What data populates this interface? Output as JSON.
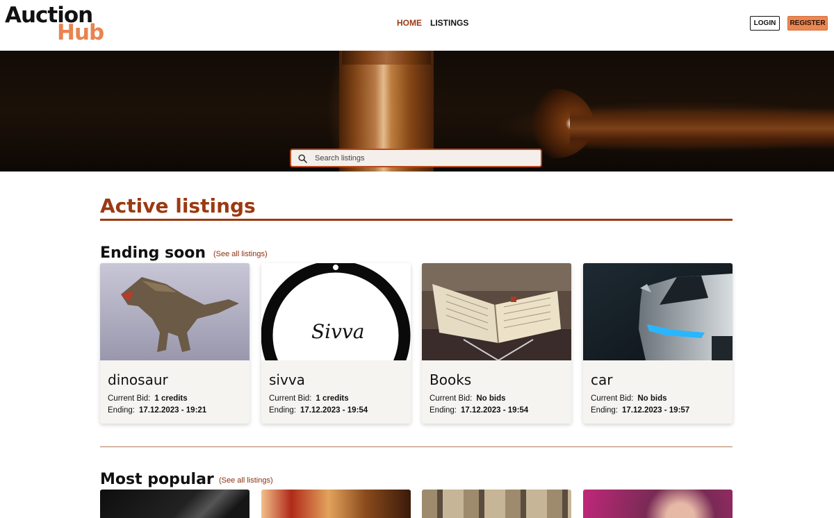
{
  "header": {
    "logo_top": "Auction",
    "logo_bottom": "Hub",
    "nav": [
      {
        "label": "HOME",
        "active": true
      },
      {
        "label": "LISTINGS",
        "active": false
      }
    ],
    "login_label": "LOGIN",
    "register_label": "REGISTER"
  },
  "hero": {
    "search_placeholder": "Search listings",
    "search_icon": "search-icon"
  },
  "main": {
    "section_title": "Active listings",
    "ending_soon": {
      "title": "Ending soon",
      "see_all": "(See all listings)",
      "cards": [
        {
          "title": "dinosaur",
          "bid_label": "Current Bid:",
          "bid_value": "1 credits",
          "ending_label": "Ending:",
          "ending_value": "17.12.2023 - 19:21"
        },
        {
          "title": "sivva",
          "bid_label": "Current Bid:",
          "bid_value": "1 credits",
          "ending_label": "Ending:",
          "ending_value": "17.12.2023 - 19:54"
        },
        {
          "title": "Books",
          "bid_label": "Current Bid:",
          "bid_value": "No bids",
          "ending_label": "Ending:",
          "ending_value": "17.12.2023 - 19:54"
        },
        {
          "title": "car",
          "bid_label": "Current Bid:",
          "bid_value": "No bids",
          "ending_label": "Ending:",
          "ending_value": "17.12.2023 - 19:57"
        }
      ],
      "sivva_logo_text": "Sivva"
    },
    "most_popular": {
      "title": "Most popular",
      "see_all": "(See all listings)"
    }
  },
  "colors": {
    "brand_dark": "#9b3a12",
    "brand_orange": "#ea8752",
    "card_bg": "#f6f4f1"
  }
}
